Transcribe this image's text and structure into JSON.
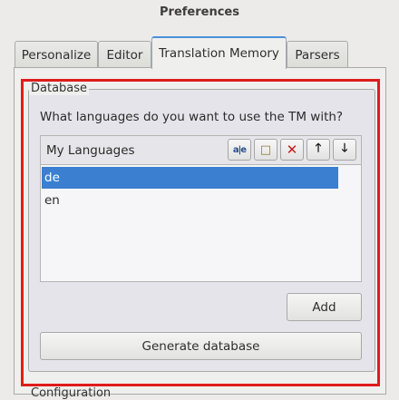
{
  "window": {
    "title": "Preferences"
  },
  "tabs": [
    {
      "label": "Personalize"
    },
    {
      "label": "Editor"
    },
    {
      "label": "Translation Memory"
    },
    {
      "label": "Parsers"
    }
  ],
  "database": {
    "legend": "Database",
    "question": "What languages do you want to use the TM with?",
    "list_header": "My Languages",
    "toolbar": [
      {
        "icon": "rename-icon",
        "glyph": "a|e"
      },
      {
        "icon": "new-item-icon",
        "glyph": "□"
      },
      {
        "icon": "delete-icon",
        "glyph": "✕"
      },
      {
        "icon": "arrow-up-icon",
        "glyph": "🡑"
      },
      {
        "icon": "arrow-down-icon",
        "glyph": "🡓"
      }
    ],
    "items": [
      {
        "label": "de",
        "selected": true
      },
      {
        "label": "en",
        "selected": false
      }
    ],
    "add_label": "Add",
    "generate_label": "Generate database"
  },
  "next_group_legend": "Configuration",
  "colors": {
    "highlight": "#e01c1c",
    "selection": "#3b7fd0",
    "active_tab_accent": "#4a90d9"
  }
}
